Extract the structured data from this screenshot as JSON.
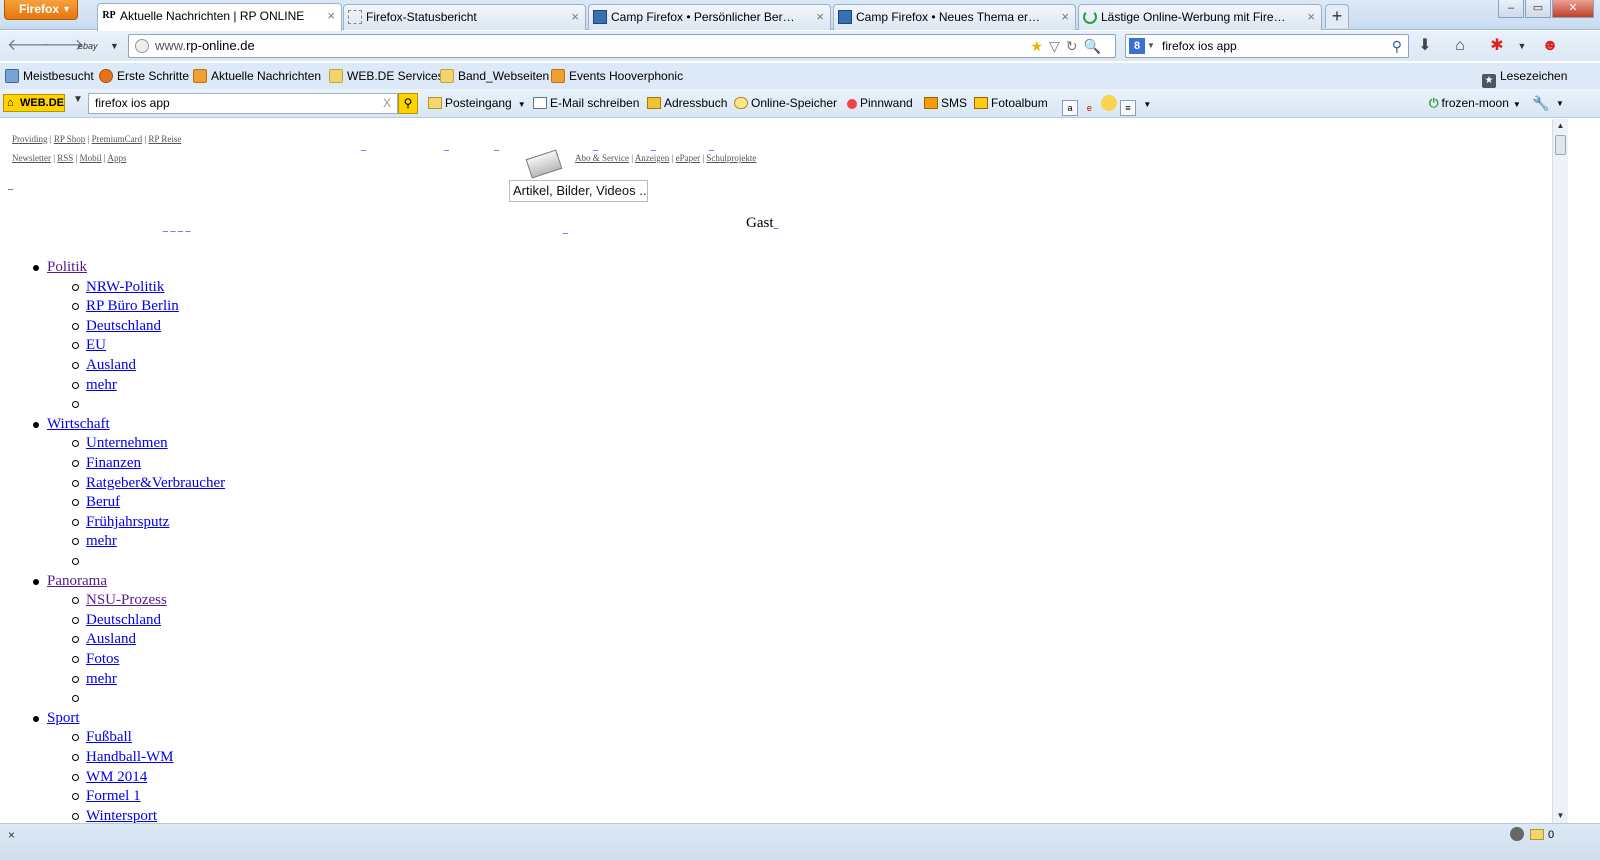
{
  "browser": {
    "menu_button": "Firefox",
    "tabs": [
      {
        "title": "Aktuelle Nachrichten | RP ONLINE",
        "icon": "RP",
        "active": true
      },
      {
        "title": "Firefox-Statusbericht",
        "icon": "",
        "active": false
      },
      {
        "title": "Camp Firefox • Persönlicher Bereich •...",
        "icon": "",
        "active": false
      },
      {
        "title": "Camp Firefox • Neues Thema erstellen",
        "icon": "",
        "active": false
      },
      {
        "title": "Lästige Online-Werbung mit Firefox a...",
        "icon": "",
        "active": false
      }
    ],
    "new_tab": "+",
    "window_controls": {
      "minimize": "–",
      "maximize": "▭",
      "close": "✕"
    }
  },
  "navbar": {
    "engine_label": "ebay",
    "url_prefix": "www.",
    "url_domain": "rp-online.de",
    "search_value": "firefox ios app",
    "search_engine": "8"
  },
  "bookmarks": [
    {
      "label": "Meistbesucht",
      "icon": "mb"
    },
    {
      "label": "Erste Schritte",
      "icon": "ff"
    },
    {
      "label": "Aktuelle Nachrichten",
      "icon": "rss"
    },
    {
      "label": "WEB.DE Services",
      "icon": "folder"
    },
    {
      "label": "Band_Webseiten",
      "icon": "folder"
    },
    {
      "label": "Events Hooverphonic",
      "icon": "rss"
    }
  ],
  "bookmarks_right": "Lesezeichen",
  "webde": {
    "logo": "WEB.DE",
    "search_value": "firefox ios app",
    "clear": "X",
    "items": [
      {
        "label": "Posteingang",
        "icon": "mail"
      },
      {
        "label": "E-Mail schreiben",
        "icon": "edit"
      },
      {
        "label": "Adressbuch",
        "icon": "book"
      },
      {
        "label": "Online-Speicher",
        "icon": "cloud"
      },
      {
        "label": "Pinnwand",
        "icon": "pin"
      },
      {
        "label": "SMS",
        "icon": "sms"
      },
      {
        "label": "Fotoalbum",
        "icon": "photo"
      }
    ],
    "user": "frozen-moon"
  },
  "page": {
    "top_links_row1": [
      "Providing",
      "RP Shop",
      "PremiumCard",
      "RP Reise"
    ],
    "top_links_row2": [
      "Newsletter",
      "RSS",
      "Mobil",
      "Apps"
    ],
    "service_links": [
      "Abo & Service",
      "Anzeigen",
      "ePaper",
      "Schulprojekte"
    ],
    "search_placeholder": "Artikel, Bilder, Videos ...",
    "user_label": "Gast",
    "menu": [
      {
        "label": "Politik",
        "visited": true,
        "children": [
          "NRW-Politik",
          "RP Büro Berlin",
          "Deutschland",
          "EU",
          "Ausland",
          "mehr",
          ""
        ]
      },
      {
        "label": "Wirtschaft",
        "visited": false,
        "children": [
          "Unternehmen",
          "Finanzen",
          "Ratgeber&Verbraucher",
          "Beruf",
          "Frühjahrsputz",
          "mehr",
          ""
        ]
      },
      {
        "label": "Panorama",
        "visited": true,
        "children": [
          "NSU-Prozess",
          "Deutschland",
          "Ausland",
          "Fotos",
          "mehr",
          ""
        ]
      },
      {
        "label": "Sport",
        "visited": false,
        "children": [
          "Fußball",
          "Handball-WM",
          "WM 2014",
          "Formel 1",
          "Wintersport"
        ]
      }
    ]
  },
  "status": {
    "close": "×",
    "count": "0"
  }
}
